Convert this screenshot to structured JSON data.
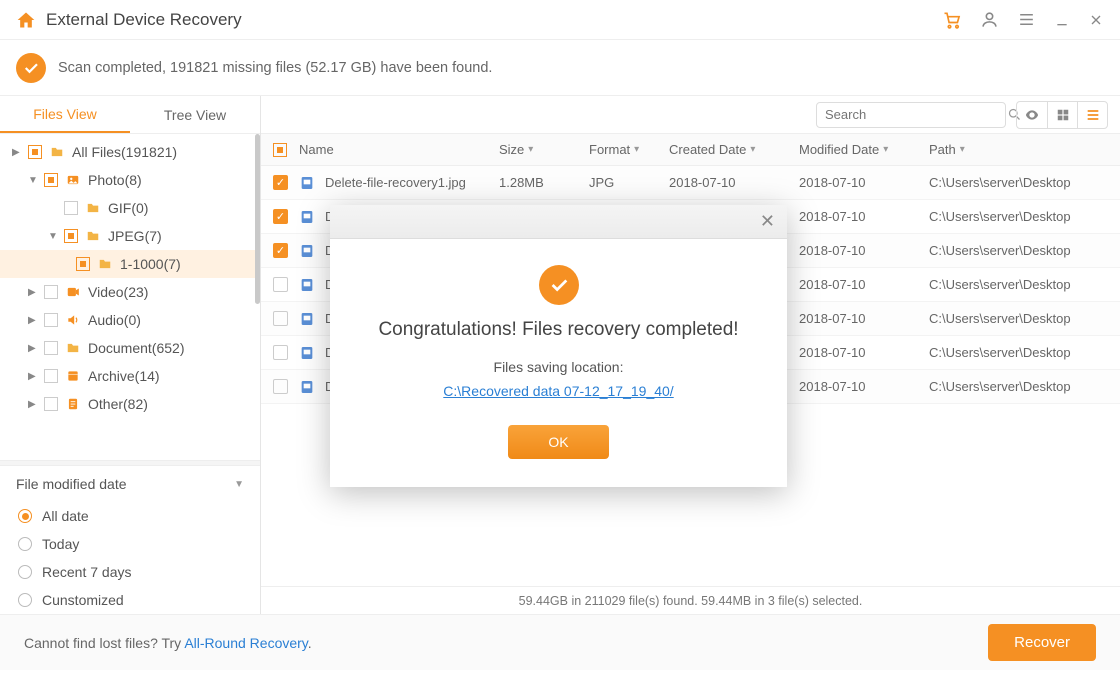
{
  "titlebar": {
    "title": "External Device Recovery"
  },
  "scanbar": {
    "text": "Scan completed, 191821 missing files (52.17 GB) have been found."
  },
  "sidebar": {
    "tabs": {
      "files": "Files View",
      "tree": "Tree View"
    },
    "nodes": {
      "all": "All Files(191821)",
      "photo": "Photo(8)",
      "gif": "GIF(0)",
      "jpeg": "JPEG(7)",
      "jpeg_range": "1-1000(7)",
      "video": "Video(23)",
      "audio": "Audio(0)",
      "document": "Document(652)",
      "archive": "Archive(14)",
      "other": "Other(82)"
    },
    "filter": {
      "title": "File modified date",
      "opts": {
        "all": "All date",
        "today": "Today",
        "recent7": "Recent 7 days",
        "custom": "Cunstomized"
      }
    }
  },
  "toolbar": {
    "search_placeholder": "Search"
  },
  "columns": {
    "name": "Name",
    "size": "Size",
    "format": "Format",
    "created": "Created Date",
    "modified": "Modified Date",
    "path": "Path"
  },
  "rows": [
    {
      "checked": true,
      "name": "Delete-file-recovery1.jpg",
      "size": "1.28MB",
      "format": "JPG",
      "created": "2018-07-10",
      "modified": "2018-07-10",
      "path": "C:\\Users\\server\\Desktop"
    },
    {
      "checked": true,
      "name": "De",
      "size": "",
      "format": "",
      "created": "",
      "modified": "2018-07-10",
      "path": "C:\\Users\\server\\Desktop"
    },
    {
      "checked": true,
      "name": "De",
      "size": "",
      "format": "",
      "created": "",
      "modified": "2018-07-10",
      "path": "C:\\Users\\server\\Desktop"
    },
    {
      "checked": false,
      "name": "De",
      "size": "",
      "format": "",
      "created": "",
      "modified": "2018-07-10",
      "path": "C:\\Users\\server\\Desktop"
    },
    {
      "checked": false,
      "name": "De",
      "size": "",
      "format": "",
      "created": "",
      "modified": "2018-07-10",
      "path": "C:\\Users\\server\\Desktop"
    },
    {
      "checked": false,
      "name": "De",
      "size": "",
      "format": "",
      "created": "",
      "modified": "2018-07-10",
      "path": "C:\\Users\\server\\Desktop"
    },
    {
      "checked": false,
      "name": "De",
      "size": "",
      "format": "",
      "created": "",
      "modified": "2018-07-10",
      "path": "C:\\Users\\server\\Desktop"
    }
  ],
  "statusbar": {
    "text": "59.44GB in 211029 file(s) found.  59.44MB in 3 file(s) selected."
  },
  "footer": {
    "hint_prefix": "Cannot find lost files? Try ",
    "hint_link": "All-Round Recovery",
    "recover": "Recover"
  },
  "dialog": {
    "title": "Congratulations! Files recovery completed!",
    "sub": "Files saving location:",
    "location": "C:\\Recovered data 07-12_17_19_40/",
    "ok": "OK"
  }
}
